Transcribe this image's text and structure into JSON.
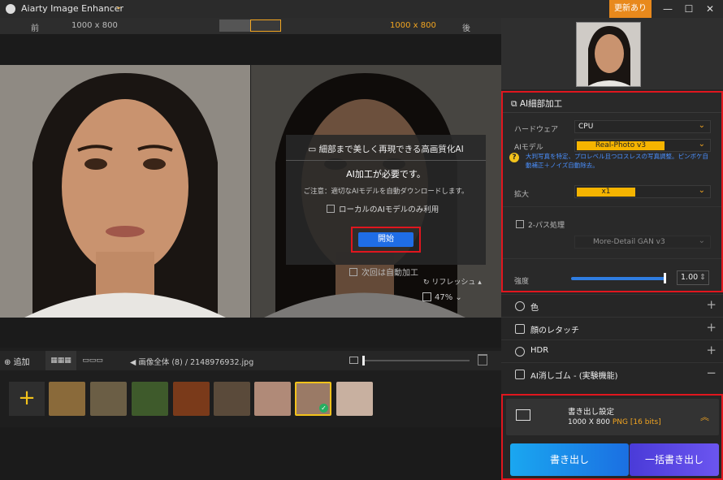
{
  "app": {
    "title": "Aiarty Image Enhancer",
    "update": "更新あり"
  },
  "compare": {
    "before": "前",
    "before_size": "1000 x 800",
    "after_size": "1000 x 800",
    "after": "後"
  },
  "dialog": {
    "header": "細部まで美しく再現できる高画質化AI",
    "required": "AI加工が必要です。",
    "note": "ご注意：適切なAIモデルを自動ダウンロードします。",
    "local_only": "ローカルのAIモデルのみ利用",
    "start": "開始"
  },
  "preview": {
    "auto_label": "次回は自動加工",
    "refresh": "リフレッシュ",
    "zoom": "47%"
  },
  "bottom": {
    "add": "追加",
    "path_prefix": "画像全体 (8)",
    "sep": "/",
    "file": "2148976932.jpg"
  },
  "thumbs": [
    {
      "name": "tiger",
      "color": "#8a6a3a"
    },
    {
      "name": "snake",
      "color": "#6b5e45"
    },
    {
      "name": "forest",
      "color": "#3e5a2b"
    },
    {
      "name": "burger",
      "color": "#7a3a1a"
    },
    {
      "name": "dog",
      "color": "#5a4a3a"
    },
    {
      "name": "woman",
      "color": "#b08a78"
    },
    {
      "name": "selected-face",
      "color": "#9a7a66"
    },
    {
      "name": "eyes",
      "color": "#c8b0a0"
    }
  ],
  "right": {
    "ai_title": "AI細部加工",
    "hardware_label": "ハードウェア",
    "hardware_value": "CPU",
    "model_label": "AIモデル",
    "model_value": "Real-Photo  v3",
    "hint": "大判写真を特定、プロレベル且つロスレスの写真調整。ピンボケ自動補正＋ノイズ自動除去。",
    "scale_label": "拡大",
    "scale_value": "x1",
    "twopass_label": "2-パス処理",
    "twopass_model": "More-Detail GAN  v3",
    "strength_label": "強度",
    "strength_value": "1.00",
    "strength_fraction": 1.0,
    "features": [
      "色",
      "顔のレタッチ",
      "HDR",
      "AI消しゴム - (実験機能)"
    ],
    "export_title": "書き出し設定",
    "export_size": "1000 X 800",
    "export_format": "PNG",
    "export_bits": "[16 bits]",
    "export_btn": "書き出し",
    "batch_btn": "一括書き出し"
  }
}
